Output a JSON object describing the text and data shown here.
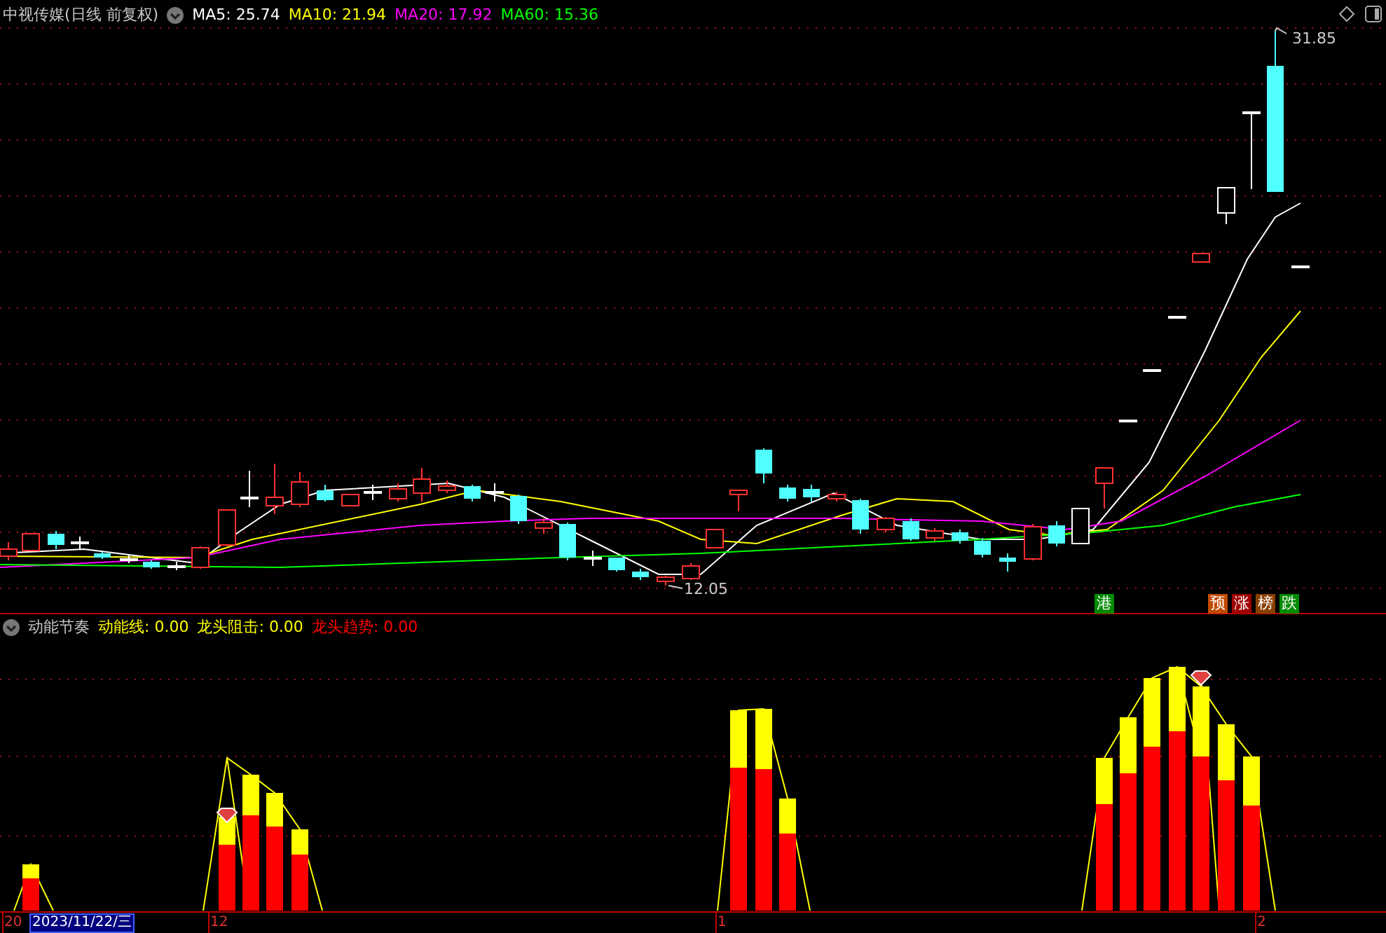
{
  "main_chart": {
    "title": "中视传媒(日线 前复权)",
    "indicators": [
      {
        "label": "MA5:",
        "value": "25.74",
        "color": "#ffffff"
      },
      {
        "label": "MA10:",
        "value": "21.94",
        "color": "#ffff00"
      },
      {
        "label": "MA20:",
        "value": "17.92",
        "color": "#ff00ff"
      },
      {
        "label": "MA60:",
        "value": "15.36",
        "color": "#00ff00"
      }
    ],
    "high_label": "31.85",
    "low_label": "12.05",
    "tags": [
      {
        "text": "港",
        "color": "#008a00"
      },
      {
        "text": "预",
        "color": "#c04a00"
      },
      {
        "text": "涨",
        "color": "#a00000"
      },
      {
        "text": "榜",
        "color": "#8a4000"
      },
      {
        "text": "跌",
        "color": "#008a00"
      }
    ]
  },
  "sub_chart": {
    "title": "动能节奏",
    "indicators": [
      {
        "label": "动能线:",
        "value": "0.00",
        "color": "#ffff00"
      },
      {
        "label": "龙头阻击:",
        "value": "0.00",
        "color": "#ffff00"
      },
      {
        "label": "龙头趋势:",
        "value": "0.00",
        "color": "#ff0000"
      }
    ]
  },
  "time_axis": {
    "labels": [
      "20",
      "12",
      "1",
      "2"
    ],
    "cursor_date": "2023/11/22/三"
  }
}
